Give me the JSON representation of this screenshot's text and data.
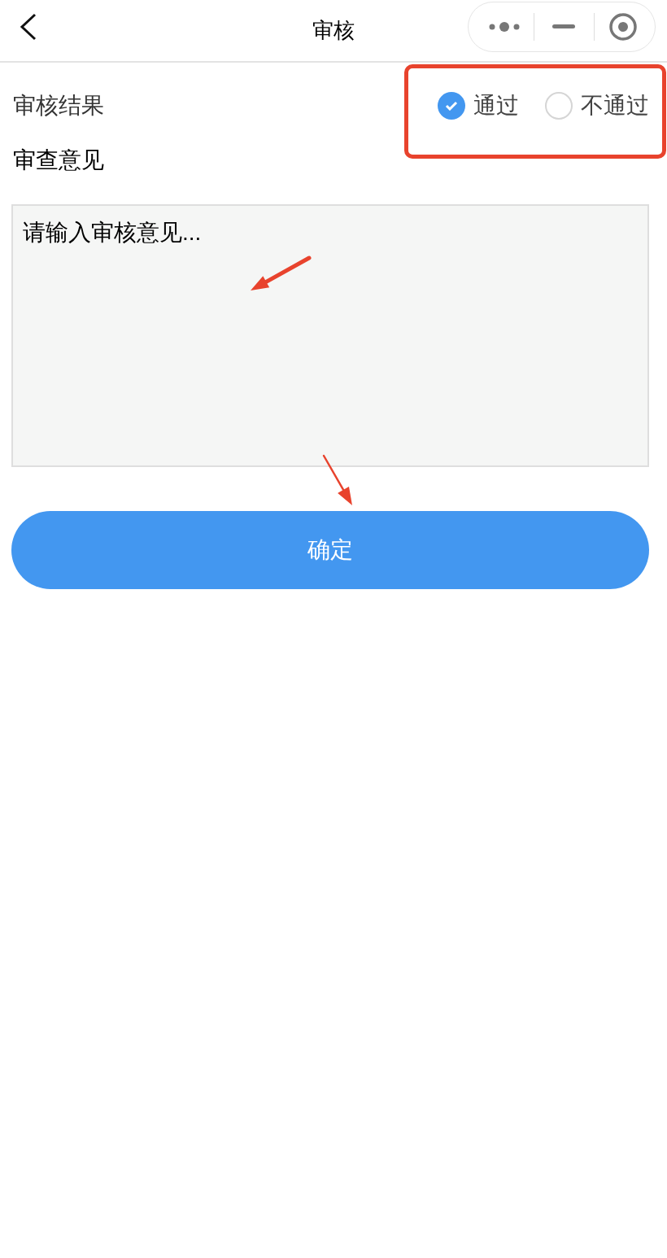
{
  "nav": {
    "title": "审核"
  },
  "result": {
    "label": "审核结果",
    "options": [
      {
        "label": "通过",
        "selected": true
      },
      {
        "label": "不通过",
        "selected": false
      }
    ]
  },
  "opinion": {
    "label": "审查意见",
    "placeholder": "请输入审核意见..."
  },
  "submit": {
    "label": "确定"
  }
}
